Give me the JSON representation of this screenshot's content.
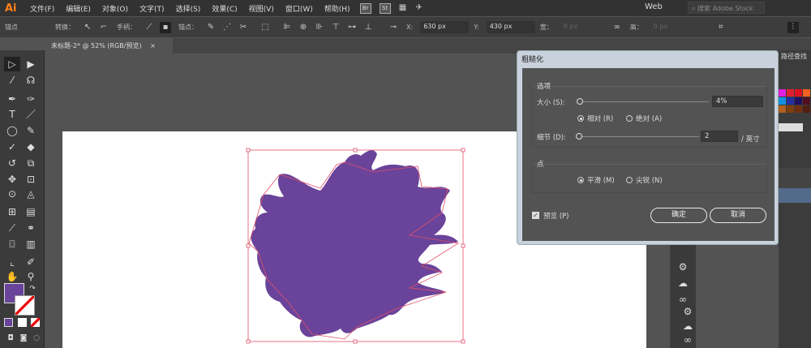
{
  "app": {
    "logo": "Ai",
    "menus": [
      "文件(F)",
      "编辑(E)",
      "对象(O)",
      "文字(T)",
      "选择(S)",
      "效果(C)",
      "视图(V)",
      "窗口(W)",
      "帮助(H)"
    ],
    "bridge": "Br",
    "stock_icon": "St",
    "workspace": "Web",
    "stock_search_placeholder": "搜索 Adobe Stock"
  },
  "control": {
    "anchor_label": "锚点",
    "convert_label": "转换：",
    "handles_label": "手柄：",
    "anchors_label": "锚点：",
    "x_label": "X:",
    "x_value": "630 px",
    "y_label": "Y:",
    "y_value": "430 px",
    "w_label": "宽：",
    "w_value": "0 px",
    "h_label": "高：",
    "h_value": "0 px"
  },
  "document": {
    "tab_title": "未标题-2* @ 52% (RGB/预览)",
    "close": "×"
  },
  "colors": {
    "fill": "#6a439a",
    "accent": "#ff7f18",
    "selection": "#e0506a"
  },
  "right_panel": {
    "title": "路径查找"
  },
  "dialog": {
    "title": "粗糙化",
    "options_label": "选项",
    "size_label": "大小 (S):",
    "size_value": "4%",
    "size_slider_percent": 4,
    "relative_label": "相对 (R)",
    "absolute_label": "绝对 (A)",
    "relative_selected": true,
    "detail_label": "细节 (D):",
    "detail_value": "2",
    "detail_unit": "/ 英寸",
    "points_label": "点",
    "smooth_label": "平滑 (M)",
    "corner_label": "尖锐 (N)",
    "smooth_selected": true,
    "preview_label": "预览 (P)",
    "preview_checked": true,
    "ok_label": "确定",
    "cancel_label": "取消"
  }
}
